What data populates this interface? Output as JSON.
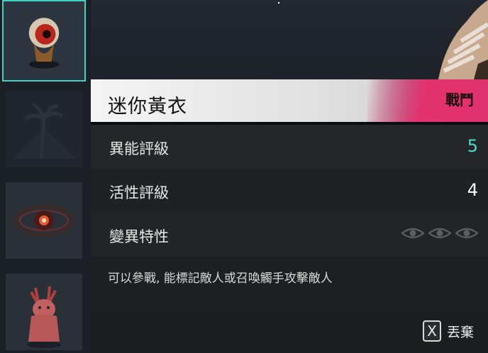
{
  "item": {
    "name": "迷你黃衣",
    "tag": "戰鬥"
  },
  "stats": [
    {
      "label": "異能評級",
      "value": "5"
    },
    {
      "label": "活性評級",
      "value": "4"
    },
    {
      "label": "變異特性",
      "eyes": 3
    }
  ],
  "description": "可以參戰, 能標記敵人或召喚觸手攻擊敵人",
  "actions": {
    "discard_key": "X",
    "discard_label": "丟棄"
  },
  "colors": {
    "accent": "#43e0c8",
    "selection": "#3fd2c3",
    "tag_pink": "#e2336f"
  },
  "inventory": [
    {
      "icon": "mini-yellow-robe-creature-icon",
      "selected": true
    },
    {
      "icon": "palm-tree-placeholder-icon",
      "locked": true
    },
    {
      "icon": "eye-orb-artifact-icon"
    },
    {
      "icon": "red-rabbit-creature-icon"
    }
  ]
}
